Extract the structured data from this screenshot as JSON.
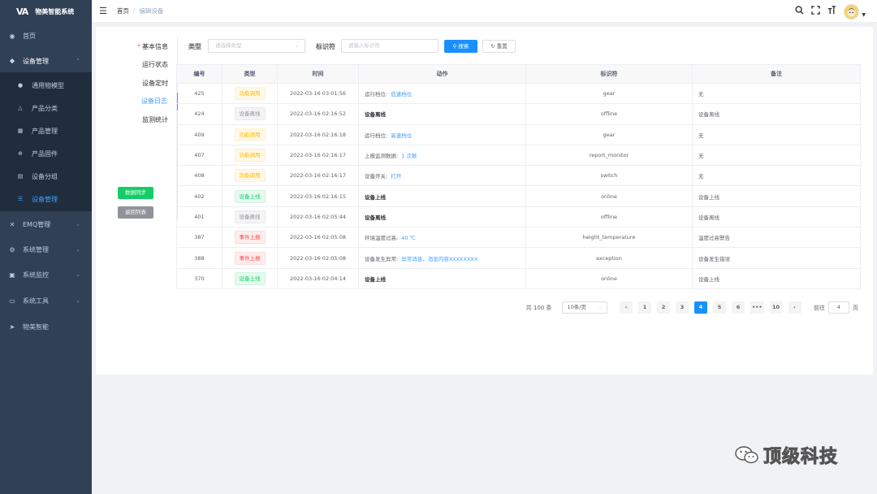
{
  "sidebar": {
    "logo_mark": "VA",
    "title": "物美智能系统",
    "menu": [
      {
        "label": "首页",
        "icon": "dashboard-icon"
      },
      {
        "label": "设备管理",
        "icon": "cube-icon"
      },
      {
        "label": "EMQ管理",
        "icon": "cross-icon"
      },
      {
        "label": "系统管理",
        "icon": "gear-icon"
      },
      {
        "label": "系统监控",
        "icon": "monitor-icon"
      },
      {
        "label": "系统工具",
        "icon": "toolbox-icon"
      },
      {
        "label": "物美智能",
        "icon": "send-icon"
      }
    ],
    "submenu": [
      {
        "label": "通用物模型",
        "icon": "model-icon"
      },
      {
        "label": "产品分类",
        "icon": "tree-icon"
      },
      {
        "label": "产品管理",
        "icon": "grid-icon"
      },
      {
        "label": "产品固件",
        "icon": "firmware-icon"
      },
      {
        "label": "设备分组",
        "icon": "table-icon"
      },
      {
        "label": "设备管理",
        "icon": "list-icon"
      }
    ]
  },
  "navbar": {
    "breadcrumb_home": "首页",
    "breadcrumb_sep": "/",
    "breadcrumb_current": "编辑设备"
  },
  "tabs": [
    {
      "label": "基本信息",
      "required": "*"
    },
    {
      "label": "运行状态"
    },
    {
      "label": "设备定时"
    },
    {
      "label": "设备日志"
    },
    {
      "label": "监测统计"
    }
  ],
  "buttons": {
    "sync": "数据同步",
    "back": "返回列表",
    "search": "搜索",
    "reset": "重置"
  },
  "filters": {
    "type_label": "类型",
    "type_placeholder": "请选择类型",
    "id_label": "标识符",
    "id_placeholder": "请输入标识符"
  },
  "table": {
    "headers": [
      "编号",
      "类型",
      "时间",
      "动作",
      "标识符",
      "备注"
    ],
    "rows": [
      {
        "id": "425",
        "tag": "功能调用",
        "tag_kind": "warn",
        "time": "2022-03-16 03:01:56",
        "action": "运行档位:",
        "action_value": "低速档位",
        "action_bold": false,
        "identifier": "gear",
        "remark": "无"
      },
      {
        "id": "424",
        "tag": "设备离线",
        "tag_kind": "info",
        "time": "2022-03-16 02:16:52",
        "action": "设备离线",
        "action_value": "",
        "action_bold": true,
        "identifier": "offline",
        "remark": "设备离线"
      },
      {
        "id": "409",
        "tag": "功能调用",
        "tag_kind": "warn",
        "time": "2022-03-16 02:16:18",
        "action": "运行档位:",
        "action_value": "高速档位",
        "action_bold": false,
        "identifier": "gear",
        "remark": "无"
      },
      {
        "id": "407",
        "tag": "功能调用",
        "tag_kind": "warn",
        "time": "2022-03-16 02:16:17",
        "action": "上报监测数据:",
        "action_value": "1 次数",
        "action_bold": false,
        "identifier": "report_monitor",
        "remark": "无"
      },
      {
        "id": "408",
        "tag": "功能调用",
        "tag_kind": "warn",
        "time": "2022-03-16 02:16:17",
        "action": "设备开关:",
        "action_value": "打开",
        "action_bold": false,
        "identifier": "switch",
        "remark": "无"
      },
      {
        "id": "402",
        "tag": "设备上线",
        "tag_kind": "success",
        "time": "2022-03-16 02:16:15",
        "action": "设备上线",
        "action_value": "",
        "action_bold": true,
        "identifier": "online",
        "remark": "设备上线"
      },
      {
        "id": "401",
        "tag": "设备离线",
        "tag_kind": "info",
        "time": "2022-03-16 02:05:44",
        "action": "设备离线",
        "action_value": "",
        "action_bold": true,
        "identifier": "offline",
        "remark": "设备离线"
      },
      {
        "id": "387",
        "tag": "事件上报",
        "tag_kind": "danger",
        "time": "2022-03-16 02:05:08",
        "action": "环境温度过高:",
        "action_value": "40 ℃",
        "action_bold": false,
        "identifier": "height_temperature",
        "remark": "温度过高警告"
      },
      {
        "id": "388",
        "tag": "事件上报",
        "tag_kind": "danger",
        "time": "2022-03-16 02:05:08",
        "action": "设备发生异常:",
        "action_value": "异常消息，消息内容XXXXXXXX",
        "action_bold": false,
        "identifier": "exception",
        "remark": "设备发生错误"
      },
      {
        "id": "370",
        "tag": "设备上线",
        "tag_kind": "success",
        "time": "2022-03-16 02:04:14",
        "action": "设备上线",
        "action_value": "",
        "action_bold": true,
        "identifier": "online",
        "remark": "设备上线"
      }
    ]
  },
  "pagination": {
    "total": "共 100 条",
    "page_size": "10条/页",
    "prev": "‹",
    "next": "›",
    "pages": [
      "1",
      "2",
      "3",
      "4",
      "5",
      "6",
      "•••",
      "10"
    ],
    "current_page": "4",
    "jump_prefix": "前往",
    "jump_value": "4",
    "jump_suffix": "页"
  },
  "watermark": {
    "text": "顶级科技"
  },
  "colors": {
    "sidebar_bg": "#304156",
    "primary": "#1890ff",
    "success": "#13ce66",
    "warning": "#ffba00",
    "danger": "#ff4949"
  }
}
